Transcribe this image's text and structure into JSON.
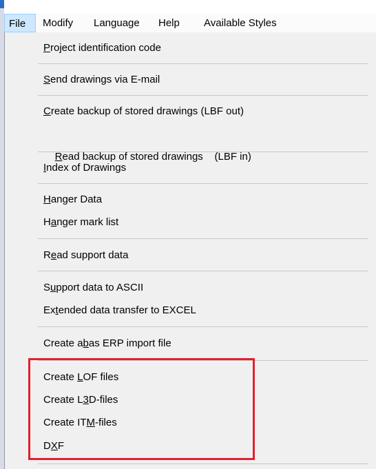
{
  "menubar": {
    "items": [
      {
        "label": "File",
        "active": true
      },
      {
        "label": "Modify"
      },
      {
        "label": "Language"
      },
      {
        "label": "Help"
      },
      {
        "label": "Available Styles"
      }
    ]
  },
  "file_menu": {
    "items": [
      {
        "pre": "",
        "u": "P",
        "post": "roject identification code"
      },
      {
        "pre": "",
        "u": "S",
        "post": "end drawings via E-mail"
      },
      {
        "pre": "",
        "u": "C",
        "post": "reate backup of stored drawings (LBF out)"
      },
      {
        "pre": "",
        "u": "R",
        "post": "ead backup of stored drawings    (LBF in)"
      },
      {
        "pre": "",
        "u": "I",
        "post": "ndex of Drawings"
      },
      {
        "pre": "",
        "u": "H",
        "post": "anger Data"
      },
      {
        "pre": "H",
        "u": "a",
        "post": "nger mark list"
      },
      {
        "pre": "R",
        "u": "e",
        "post": "ad support data"
      },
      {
        "pre": "S",
        "u": "u",
        "post": "pport data to ASCII"
      },
      {
        "pre": "Ex",
        "u": "t",
        "post": "ended data transfer to EXCEL"
      },
      {
        "pre": "Create a",
        "u": "b",
        "post": "as ERP import file"
      },
      {
        "pre": "Create ",
        "u": "L",
        "post": "OF files"
      },
      {
        "pre": "Create L",
        "u": "3",
        "post": "D-files"
      },
      {
        "pre": "Create IT",
        "u": "M",
        "post": "-files"
      },
      {
        "pre": "D",
        "u": "X",
        "post": "F"
      }
    ]
  },
  "highlight_color": "#e2202e",
  "menubar_active_bg": "#cde8ff"
}
